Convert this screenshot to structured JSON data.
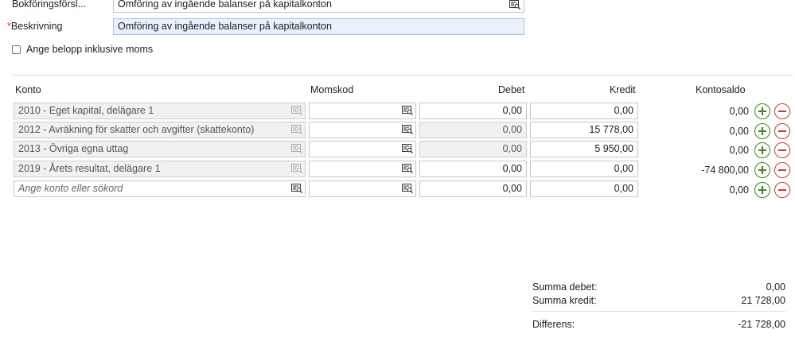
{
  "form": {
    "proposal_label": "Bokföringsförsl...",
    "proposal_value": "Omföring av ingående balanser på kapitalkonton",
    "description_required_mark": "*",
    "description_label": "Beskrivning",
    "description_value": "Omföring av ingående balanser på kapitalkonton",
    "incl_vat_label": "Ange belopp inklusive moms",
    "incl_vat_checked": false
  },
  "table": {
    "headers": {
      "account": "Konto",
      "vat_code": "Momskod",
      "debit": "Debet",
      "credit": "Kredit",
      "balance": "Kontosaldo"
    },
    "rows": [
      {
        "account": "2010 - Eget kapital, delägare 1",
        "vat_code": "",
        "debit": "0,00",
        "credit": "0,00",
        "balance": "0,00"
      },
      {
        "account": "2012 - Avräkning för skatter och avgifter (skattekonto)",
        "vat_code": "",
        "debit": "0,00",
        "credit": "15 778,00",
        "balance": "0,00"
      },
      {
        "account": "2013 - Övriga egna uttag",
        "vat_code": "",
        "debit": "0,00",
        "credit": "5 950,00",
        "balance": "0,00"
      },
      {
        "account": "2019 - Årets resultat, delägare 1",
        "vat_code": "",
        "debit": "0,00",
        "credit": "0,00",
        "balance": "-74 800,00"
      }
    ],
    "new_row": {
      "account_placeholder": "Ange konto eller sökord",
      "vat_code": "",
      "debit": "0,00",
      "credit": "0,00",
      "balance": "0,00"
    }
  },
  "summary": {
    "debit_label": "Summa debet:",
    "debit_value": "0,00",
    "credit_label": "Summa kredit:",
    "credit_value": "21 728,00",
    "diff_label": "Differens:",
    "diff_value": "-21 728,00"
  },
  "colors": {
    "plus": "#3a8a18",
    "minus": "#d03a34",
    "highlight_field": "#e9f1fc"
  }
}
